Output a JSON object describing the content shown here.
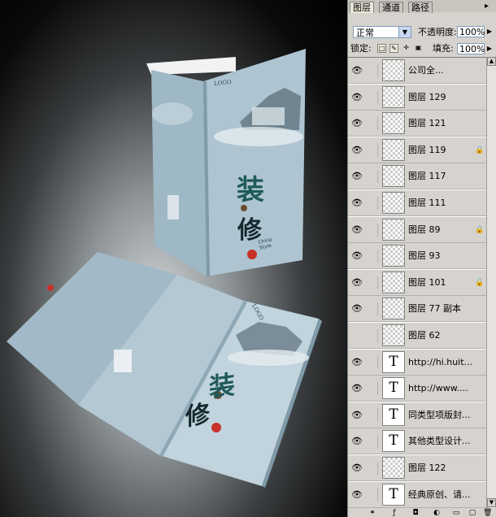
{
  "canvas": {
    "brochure": {
      "logo": "LOGO",
      "title_char_1": "装",
      "title_char_2": "修",
      "china_style": "China Style",
      "logo_open": "LOGO",
      "open_char_1": "装",
      "open_char_2": "修"
    }
  },
  "panel": {
    "tabs": [
      "图层",
      "通道",
      "路径"
    ],
    "blend_mode": "正常",
    "opacity_label": "不透明度:",
    "opacity_value": "100%",
    "lock_label": "锁定:",
    "fill_label": "填充:",
    "fill_value": "100%",
    "layers": [
      {
        "name": "公司全...",
        "type": "image",
        "visible": true,
        "locked": false
      },
      {
        "name": "图层 129",
        "type": "image",
        "visible": true,
        "locked": false
      },
      {
        "name": "图层 121",
        "type": "image",
        "visible": true,
        "locked": false
      },
      {
        "name": "图层 119",
        "type": "image",
        "visible": true,
        "locked": true
      },
      {
        "name": "图层 117",
        "type": "image",
        "visible": true,
        "locked": false
      },
      {
        "name": "图层 111",
        "type": "image",
        "visible": true,
        "locked": false
      },
      {
        "name": "图层 89",
        "type": "image",
        "visible": true,
        "locked": true
      },
      {
        "name": "图层 93",
        "type": "image",
        "visible": true,
        "locked": false
      },
      {
        "name": "图层 101",
        "type": "image",
        "visible": true,
        "locked": true
      },
      {
        "name": "图层 77 副本",
        "type": "image",
        "visible": true,
        "locked": false
      },
      {
        "name": "图层 62",
        "type": "image",
        "visible": false,
        "locked": false
      },
      {
        "name": "http://hi.huit...",
        "type": "text",
        "visible": true,
        "locked": false
      },
      {
        "name": "http://www....",
        "type": "text",
        "visible": true,
        "locked": false
      },
      {
        "name": "同类型项版封...",
        "type": "text",
        "visible": true,
        "locked": false
      },
      {
        "name": "其他类型设计...",
        "type": "text",
        "visible": true,
        "locked": false
      },
      {
        "name": "图层 122",
        "type": "image",
        "visible": true,
        "locked": false
      },
      {
        "name": "经典原创、请...",
        "type": "text",
        "visible": true,
        "locked": false
      }
    ]
  },
  "colors": {
    "brochure": "#a9c0cc",
    "brochure_dark": "#7f9aa8",
    "ink_green": "#1f5a58",
    "seal_red": "#c8322a"
  }
}
